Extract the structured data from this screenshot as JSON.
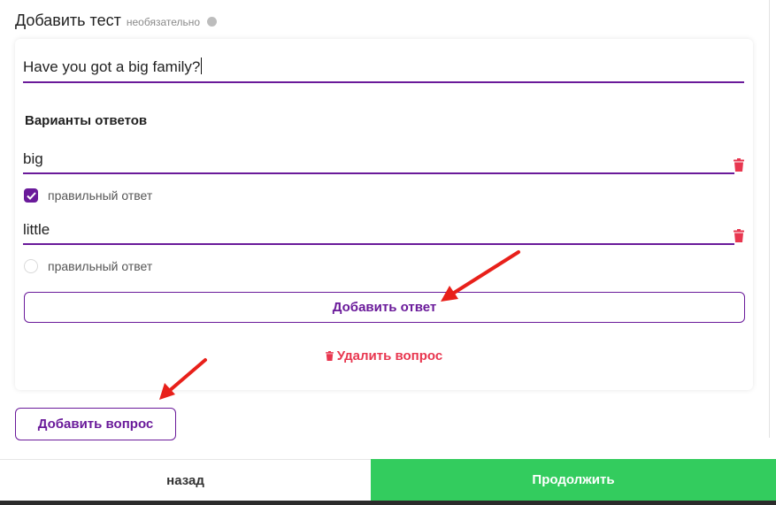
{
  "header": {
    "title": "Добавить тест",
    "optional": "необязательно"
  },
  "question": {
    "value": "Have you got a big family?"
  },
  "answers_label": "Варианты ответов",
  "answers": [
    {
      "value": "big",
      "correct_label": "правильный ответ",
      "correct": true
    },
    {
      "value": "little",
      "correct_label": "правильный ответ",
      "correct": false
    }
  ],
  "buttons": {
    "add_answer": "Добавить ответ",
    "delete_question": "Удалить вопрос",
    "add_question": "Добавить вопрос",
    "back": "назад",
    "continue": "Продолжить"
  },
  "colors": {
    "accent": "#6a1a9a",
    "danger": "#e8364f",
    "success": "#33cc5e",
    "annotation": "#e8201a"
  },
  "icons": {
    "info": "info-dot-icon",
    "trash": "trash-icon",
    "check": "check-icon",
    "annotation_arrow": "red-arrow-icon"
  }
}
